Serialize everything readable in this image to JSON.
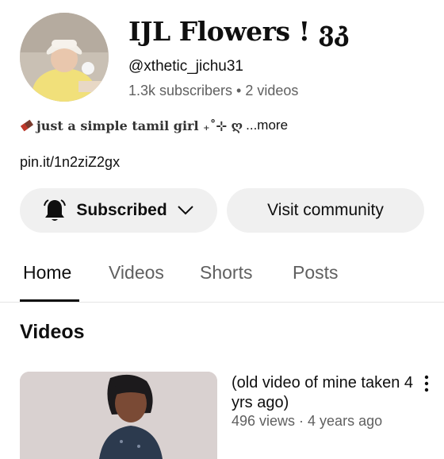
{
  "channel": {
    "name": "IJL Flowers ! ვკ",
    "handle": "@xthetic_jichu31",
    "stats": "1.3k subscribers • 2 videos",
    "bio": "just a simple tamil girl ₊˚⊹ ღ",
    "bio_more": "...more",
    "link": "pin.it/1n2ziZ2gx"
  },
  "actions": {
    "subscribed_label": "Subscribed",
    "visit_community_label": "Visit community"
  },
  "tabs": [
    {
      "label": "Home",
      "active": true
    },
    {
      "label": "Videos",
      "active": false
    },
    {
      "label": "Shorts",
      "active": false
    },
    {
      "label": "Posts",
      "active": false
    }
  ],
  "videos_section": {
    "title": "Videos",
    "items": [
      {
        "title": "(old video of mine taken 4 yrs ago)",
        "meta": "496 views · 4 years ago"
      }
    ]
  },
  "icons": {
    "bell": "bell-icon",
    "chevron": "chevron-down-icon",
    "more": "more-vert-icon"
  }
}
